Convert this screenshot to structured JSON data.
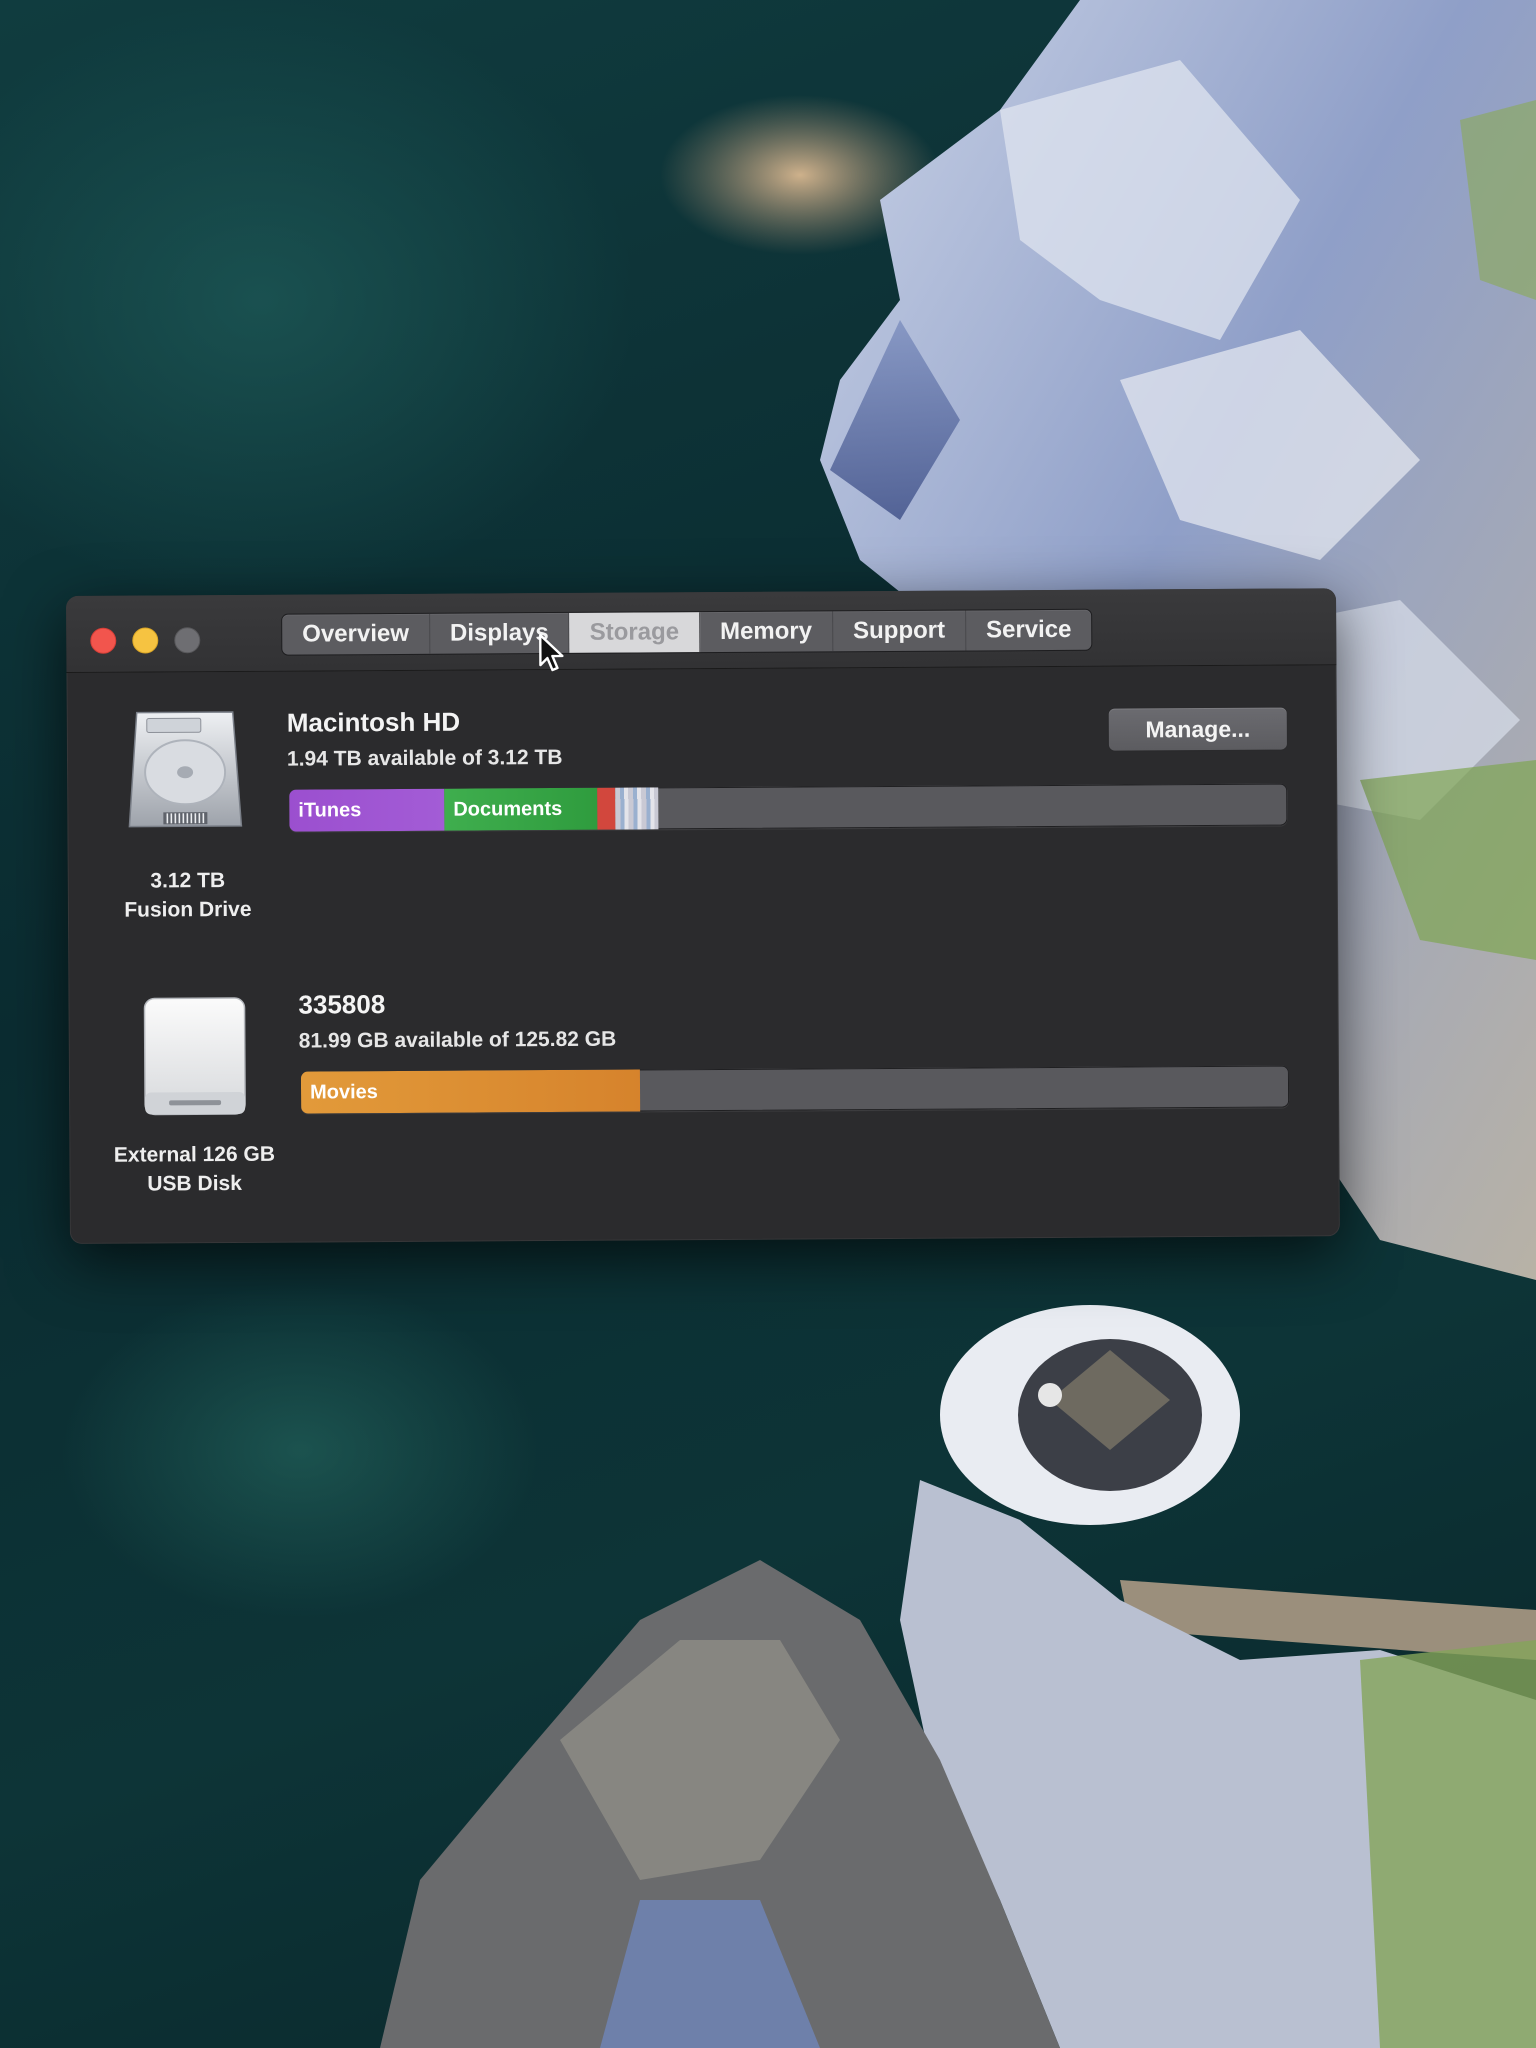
{
  "window": {
    "tabs": [
      {
        "label": "Overview",
        "selected": false
      },
      {
        "label": "Displays",
        "selected": false
      },
      {
        "label": "Storage",
        "selected": true
      },
      {
        "label": "Memory",
        "selected": false
      },
      {
        "label": "Support",
        "selected": false
      },
      {
        "label": "Service",
        "selected": false
      }
    ],
    "traffic_lights": {
      "close_color": "#f2554d",
      "minimize_color": "#f6c341",
      "zoom_color": "#6e6e72"
    }
  },
  "drives": [
    {
      "name": "Macintosh HD",
      "availability": "1.94 TB available of 3.12 TB",
      "icon": "hard-drive-icon",
      "label_line1": "3.12 TB",
      "label_line2": "Fusion Drive",
      "manage_label": "Manage...",
      "segments": [
        {
          "label": "iTunes",
          "fraction": 0.155,
          "color": "#9b4fcf",
          "color2": "#a35cd6"
        },
        {
          "label": "Documents",
          "fraction": 0.153,
          "color": "#3fae4e",
          "color2": "#2f9c3e"
        },
        {
          "label": "",
          "fraction": 0.018,
          "color": "#d2473d",
          "color2": "#d2473d"
        },
        {
          "label": "",
          "fraction": 0.043,
          "color": "other",
          "color2": "other"
        }
      ]
    },
    {
      "name": "335808",
      "availability": "81.99 GB available of 125.82 GB",
      "icon": "external-disk-icon",
      "label_line1": "External 126 GB",
      "label_line2": "USB Disk",
      "segments": [
        {
          "label": "Movies",
          "fraction": 0.343,
          "color": "#e29a3a",
          "color2": "#d6832c"
        }
      ]
    }
  ]
}
